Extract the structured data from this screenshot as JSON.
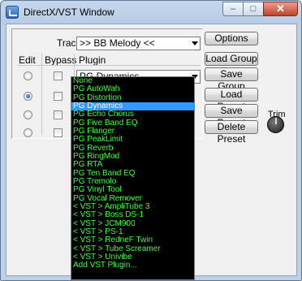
{
  "window": {
    "title": "DirectX/VST Window",
    "caption_buttons": {
      "minimize": "–",
      "maximize": "□",
      "close": "✕"
    }
  },
  "track": {
    "label": "Track",
    "value": ">> BB Melody <<"
  },
  "columns": {
    "edit": "Edit",
    "bypass": "Bypass",
    "plugin": "Plugin"
  },
  "slots": [
    {
      "edit_selected": false,
      "bypass": false,
      "plugin": "PG Dynamics"
    },
    {
      "edit_selected": true,
      "bypass": false,
      "plugin": ""
    },
    {
      "edit_selected": false,
      "bypass": false,
      "plugin": ""
    },
    {
      "edit_selected": false,
      "bypass": false,
      "plugin": ""
    }
  ],
  "buttons": {
    "options": "Options",
    "load_group": "Load Group",
    "save_group": "Save Group",
    "load_preset": "Load Preset",
    "save_preset": "Save Preset",
    "delete_preset": "Delete Preset"
  },
  "trim": {
    "label": "Trim"
  },
  "plugin_list": {
    "selected": "PG Dynamics",
    "items": [
      "None",
      "PG AutoWah",
      "PG Distortion",
      "PG Dynamics",
      "PG Echo Chorus",
      "PG Five Band EQ",
      "PG Flanger",
      "PG PeakLimit",
      "PG Reverb",
      "PG RingMod",
      "PG RTA",
      "PG Ten Band EQ",
      "PG Tremolo",
      "PG Vinyl Tool",
      "PG Vocal Remover",
      "< VST > AmpliTube 3",
      "< VST > Boss DS-1",
      "< VST > JCM900",
      "< VST > PS-1",
      "< VST > RedneF Twin",
      "< VST > Tube Screamer",
      "< VST > Univibe",
      "Add VST Plugin..."
    ]
  },
  "colors": {
    "list_bg": "#000000",
    "list_text": "#38ff38",
    "list_highlight": "#3399ff"
  }
}
